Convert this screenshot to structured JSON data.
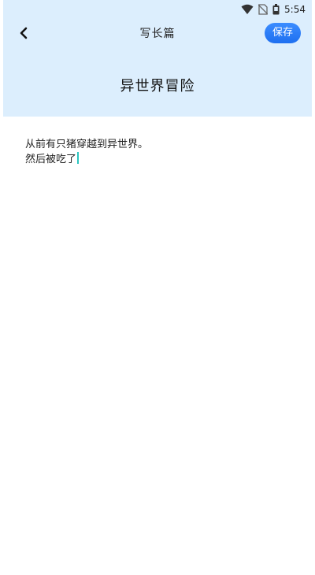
{
  "status_bar": {
    "time": "5:54",
    "icons": [
      "wifi-icon",
      "no-sim-icon",
      "battery-icon"
    ]
  },
  "nav": {
    "back_icon": "chevron-left-icon",
    "title": "写长篇",
    "save_label": "保存"
  },
  "document": {
    "title": "异世界冒险",
    "lines": [
      "从前有只猪穿越到异世界。",
      "然后被吃了"
    ]
  },
  "colors": {
    "header_bg": "#dceefd",
    "accent": "#1e6ff0",
    "caret": "#2cc5c0"
  }
}
